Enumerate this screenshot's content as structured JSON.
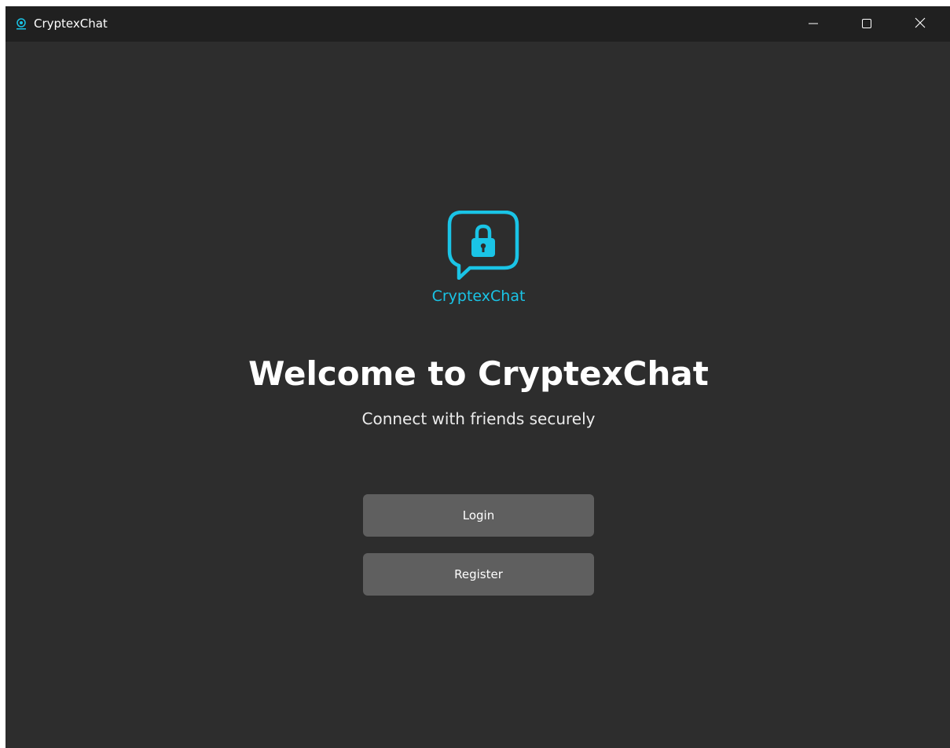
{
  "window": {
    "title": "CryptexChat",
    "controls": {
      "minimize": "minimize-icon",
      "maximize": "maximize-icon",
      "close": "close-icon"
    }
  },
  "logo": {
    "text": "CryptexChat",
    "icon": "lock-chat-bubble-icon"
  },
  "welcome": {
    "heading": "Welcome to CryptexChat",
    "subtitle": "Connect with friends securely"
  },
  "buttons": {
    "login": "Login",
    "register": "Register"
  },
  "colors": {
    "accent": "#1ac4e6",
    "background": "#2d2d2d",
    "titlebar": "#202020",
    "button": "#5f5f5f"
  }
}
